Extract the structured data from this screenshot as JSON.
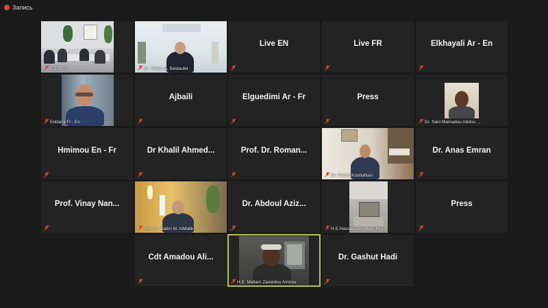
{
  "recording": {
    "label": "Запись"
  },
  "colors": {
    "background": "#1a1a1a",
    "tile": "#232323",
    "active_border": "#b5c94a",
    "mic_muted": "#d9442f"
  },
  "tiles": [
    {
      "label": "ICESCO",
      "video": true,
      "active": false
    },
    {
      "label": "Dr. Yerlan A. Baidaulet",
      "video": true,
      "active": false
    },
    {
      "label": "Live EN",
      "video": false,
      "active": false
    },
    {
      "label": "Live FR",
      "video": false,
      "active": false
    },
    {
      "label": "Elkhayali Ar - En",
      "video": false,
      "active": false
    },
    {
      "label": "Eddaira Fr - En",
      "video": true,
      "active": false
    },
    {
      "label": "Ajbaili",
      "video": false,
      "active": false
    },
    {
      "label": "Elguedimi Ar - Fr",
      "video": false,
      "active": false
    },
    {
      "label": "Press",
      "video": false,
      "active": false
    },
    {
      "label": "Dr. Sani Mamadou Abdou ...",
      "video": true,
      "active": false
    },
    {
      "label": "Hmimou En - Fr",
      "video": false,
      "active": false
    },
    {
      "label": "Dr Khalil Ahmed...",
      "video": false,
      "active": false
    },
    {
      "label": "Prof. Dr. Roman...",
      "video": false,
      "active": false
    },
    {
      "label": "Dr. Parviz Koohafkan",
      "video": true,
      "active": false
    },
    {
      "label": "Dr. Anas Emran",
      "video": false,
      "active": false
    },
    {
      "label": "Prof. Vinay Nan...",
      "video": false,
      "active": false
    },
    {
      "label": "H.E. Dr. Salim M. AlMalik",
      "video": true,
      "active": false
    },
    {
      "label": "Dr. Abdoul Aziz...",
      "video": false,
      "active": false
    },
    {
      "label": "H.E.Hassan Zeinabou Ibra...",
      "video": true,
      "active": false
    },
    {
      "label": "Press",
      "video": false,
      "active": false
    },
    {
      "label": "Cdt Amadou Ali...",
      "video": false,
      "active": false
    },
    {
      "label": "H.E. Mallam Zaneidou Amirou",
      "video": true,
      "active": true
    },
    {
      "label": "Dr. Gashut Hadi",
      "video": false,
      "active": false
    }
  ]
}
